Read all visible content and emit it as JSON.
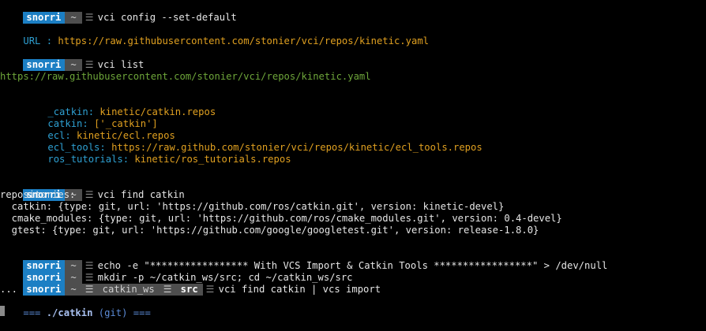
{
  "prompt": {
    "user": "snorri",
    "dir": "~",
    "sep_glyph": "☰"
  },
  "block1": {
    "command": "vci config --set-default",
    "output_label": "URL : ",
    "output_url": "https://raw.githubusercontent.com/stonier/vci/repos/kinetic.yaml"
  },
  "block2": {
    "command": "vci list",
    "url": "https://raw.githubusercontent.com/stonier/vci/repos/kinetic.yaml",
    "entries": [
      {
        "key": "_catkin: ",
        "value": "kinetic/catkin.repos"
      },
      {
        "key": "catkin: ",
        "value": "['_catkin']"
      },
      {
        "key": "ecl: ",
        "value": "kinetic/ecl.repos"
      },
      {
        "key": "ecl_tools: ",
        "value": "https://raw.github.com/stonier/vci/repos/kinetic/ecl_tools.repos"
      },
      {
        "key": "ros_tutorials: ",
        "value": "kinetic/ros_tutorials.repos"
      }
    ]
  },
  "block3": {
    "command": "vci find catkin",
    "lines": [
      "repositories:",
      "  catkin: {type: git, url: 'https://github.com/ros/catkin.git', version: kinetic-devel}",
      "  cmake_modules: {type: git, url: 'https://github.com/ros/cmake_modules.git', version: 0.4-devel}",
      "  gtest: {type: git, url: 'https://github.com/google/googletest.git', version: release-1.8.0}"
    ]
  },
  "block4": {
    "command1": "echo -e \"***************** With VCS Import & Catkin Tools *****************\" > /dev/null",
    "command2": "mkdir -p ~/catkin_ws/src; cd ~/catkin_ws/src",
    "path_dir1": "catkin_ws",
    "path_dir2": "src",
    "command3": "vci find catkin | vcs import",
    "dots": "...",
    "hdr_prefix": "=== ",
    "hdr_name": "./catkin",
    "hdr_vcs": " (git)",
    "hdr_suffix": " ==="
  },
  "colors": {
    "user_bg": "#1c7fc4",
    "dir_bg": "#4e4e4e",
    "cyan": "#2ea0d2",
    "orange": "#e0a020",
    "green": "#6ea63a",
    "header_blue": "#5c8cd8"
  },
  "icons": {
    "prompt_separator": "powerline-separator-icon",
    "cursor": "block-cursor-icon"
  }
}
